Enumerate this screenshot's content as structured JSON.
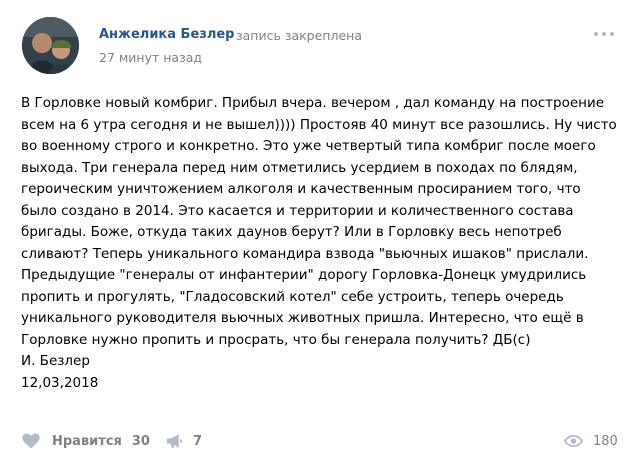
{
  "post": {
    "author": "Анжелика Безлер",
    "action": "запись закреплена",
    "time": "27 минут назад",
    "lines": [
      "В Горловке новый комбриг. Прибыл вчера. вечером , дал команду на построение",
      "всем на 6 утра сегодня и не вышел)))) Простояв 40 минут все разошлись. Ну чисто",
      "во военному строго и конкретно. Это уже четвертый типа комбриг после моего",
      "выхода. Три генерала перед ним отметились усердием в походах по блядям,",
      "героическим уничтожением алкоголя и качественным просиранием того, что",
      "было создано в 2014. Это касается и территории и количественного состава",
      "бригады. Боже, откуда таких даунов берут? Или в Горловку весь непотреб",
      "сливают? Теперь уникального командира взвода \"вьючных ишаков\" прислали.",
      "Предыдущие \"генералы от инфантерии\" дорогу Горловка-Донецк умудрились",
      "пропить и прогулять, \"Гладосовский котел\" себе устроить, теперь очередь",
      "уникального руководителя вьючных животных пришла. Интересно, что ещё в",
      "Горловке нужно пропить и просрать, что бы генерала получить? ДБ(с)",
      "И. Безлер",
      "12,03,2018"
    ]
  },
  "actions": {
    "like_label": "Нравится",
    "like_count": "30",
    "share_count": "7",
    "views_count": "180"
  },
  "icons": {
    "avatar": "avatar-photo",
    "more": "more-dots-icon",
    "like": "heart-icon",
    "share": "megaphone-icon",
    "views": "eye-icon"
  },
  "colors": {
    "link": "#2a5885",
    "meta": "#828282",
    "icon": "#b2bbc6"
  }
}
